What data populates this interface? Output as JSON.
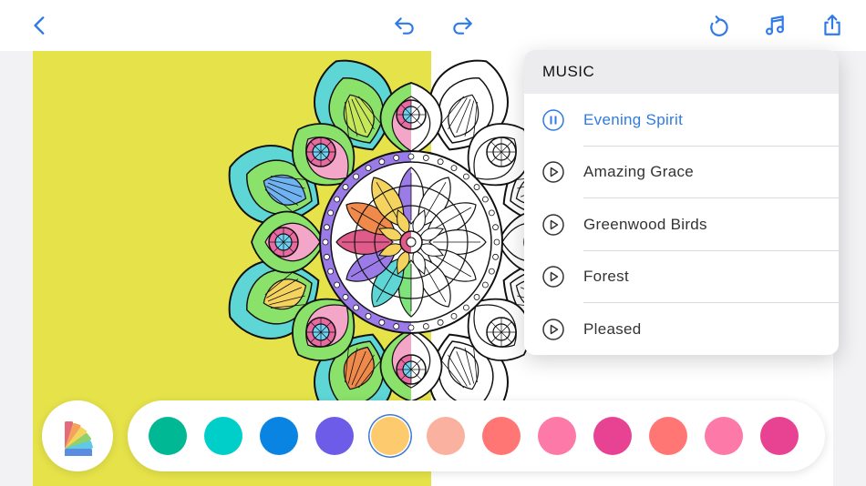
{
  "toolbar": {
    "back_icon": "chevron-left-icon",
    "undo_icon": "undo-icon",
    "redo_icon": "redo-icon",
    "reset_icon": "reset-icon",
    "music_icon": "music-note-icon",
    "share_icon": "share-icon",
    "accent": "#2f7ae5"
  },
  "canvas": {
    "fill_color": "#e6e34a"
  },
  "music": {
    "header": "MUSIC",
    "tracks": [
      {
        "name": "Evening Spirit",
        "state": "playing"
      },
      {
        "name": "Amazing Grace",
        "state": "paused"
      },
      {
        "name": "Greenwood Birds",
        "state": "paused"
      },
      {
        "name": "Forest",
        "state": "paused"
      },
      {
        "name": "Pleased",
        "state": "paused"
      }
    ]
  },
  "palette": {
    "button_icon": "color-fan-icon",
    "swatches": [
      "#00b894",
      "#00cec9",
      "#0984e3",
      "#6c5ce7",
      "#fdcb6e",
      "#fab1a0",
      "#ff7675",
      "#fd79a8",
      "#e84393",
      "#ff7675",
      "#fd79a8",
      "#e84393"
    ],
    "selected_index": 4
  }
}
